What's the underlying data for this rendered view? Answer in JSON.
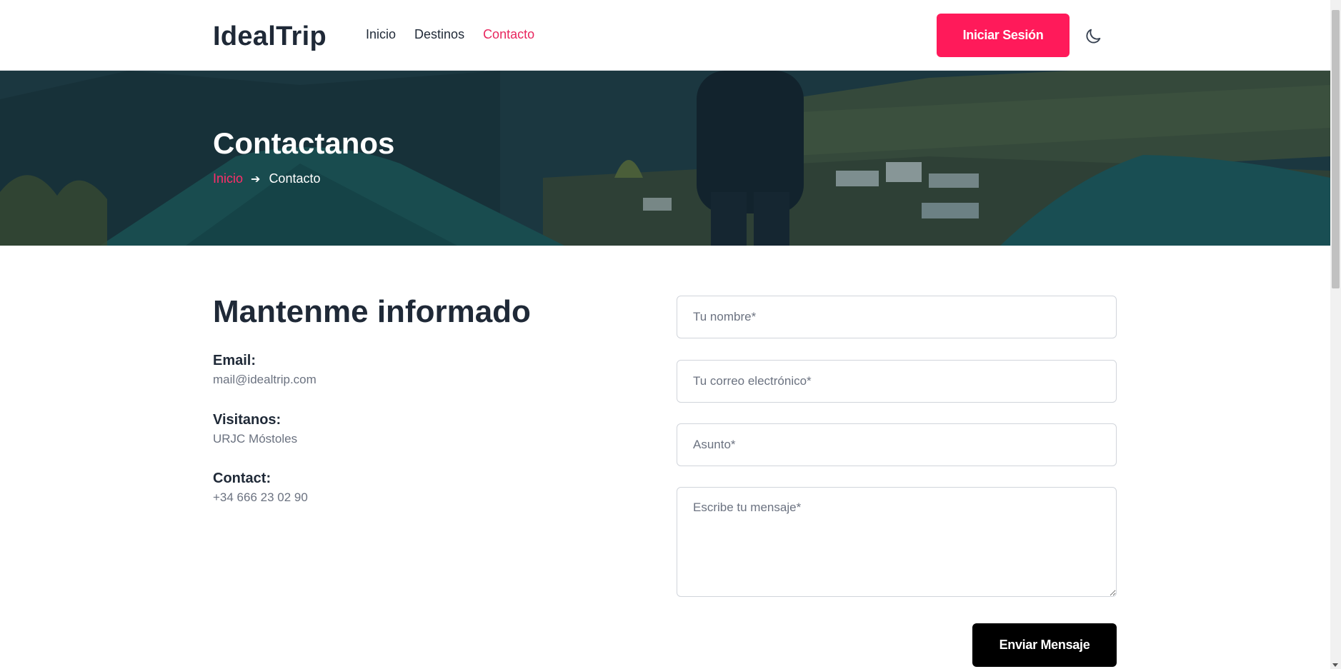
{
  "header": {
    "logo": "IdealTrip",
    "nav": [
      {
        "label": "Inicio",
        "active": false
      },
      {
        "label": "Destinos",
        "active": false
      },
      {
        "label": "Contacto",
        "active": true
      }
    ],
    "login_label": "Iniciar Sesión",
    "theme_icon": "moon-icon"
  },
  "hero": {
    "title": "Contactanos",
    "breadcrumb": {
      "home": "Inicio",
      "separator_icon": "arrow-right-icon",
      "current": "Contacto"
    }
  },
  "info": {
    "title": "Mantenme informado",
    "items": [
      {
        "label": "Email:",
        "value": "mail@idealtrip.com"
      },
      {
        "label": "Visitanos:",
        "value": "URJC Móstoles"
      },
      {
        "label": "Contact:",
        "value": "+34 666 23 02 90"
      }
    ]
  },
  "form": {
    "name_placeholder": "Tu nombre*",
    "email_placeholder": "Tu correo electrónico*",
    "subject_placeholder": "Asunto*",
    "message_placeholder": "Escribe tu mensaje*",
    "submit_label": "Enviar Mensaje"
  },
  "colors": {
    "accent": "#ff1a5a",
    "nav_active": "#e8265e",
    "dark": "#1f2937",
    "muted": "#6b7280"
  }
}
